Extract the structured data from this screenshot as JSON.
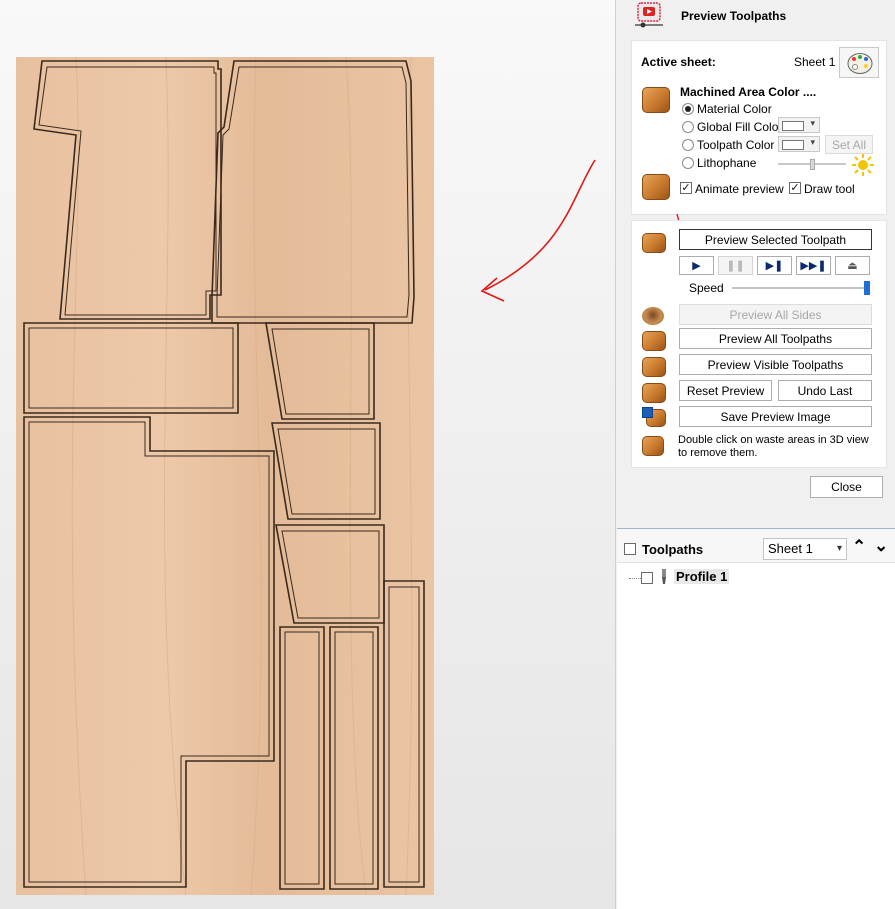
{
  "panel": {
    "title": "Preview Toolpaths",
    "active_sheet": {
      "label": "Active sheet:",
      "value": "Sheet 1"
    },
    "machined_area": {
      "heading": "Machined Area Color ....",
      "options": [
        {
          "label": "Material Color",
          "selected": true
        },
        {
          "label": "Global Fill Color",
          "selected": false
        },
        {
          "label": "Toolpath Color",
          "selected": false
        },
        {
          "label": "Lithophane",
          "selected": false
        }
      ],
      "set_all_label": "Set All"
    },
    "animate_preview": {
      "label": "Animate preview",
      "checked": true
    },
    "draw_tool": {
      "label": "Draw tool",
      "checked": true
    },
    "buttons": {
      "preview_selected": "Preview Selected Toolpath",
      "speed_label": "Speed",
      "preview_all_sides": "Preview All Sides",
      "preview_all_toolpaths": "Preview All Toolpaths",
      "preview_visible_toolpaths": "Preview Visible Toolpaths",
      "reset_preview": "Reset Preview",
      "undo_last": "Undo Last",
      "save_preview_image": "Save Preview Image",
      "close": "Close"
    },
    "hint": {
      "line1": "Double click on waste areas in 3D view",
      "line2": "to remove them."
    },
    "speed": 1.0
  },
  "toolpaths": {
    "heading": "Toolpaths",
    "sheet_select": "Sheet 1",
    "items": [
      {
        "label": "Profile 1",
        "checked": false
      }
    ]
  },
  "colors": {
    "wood": "#e9c3a2",
    "annotation": "#e01818",
    "accent_blue": "#1f6fd1"
  }
}
